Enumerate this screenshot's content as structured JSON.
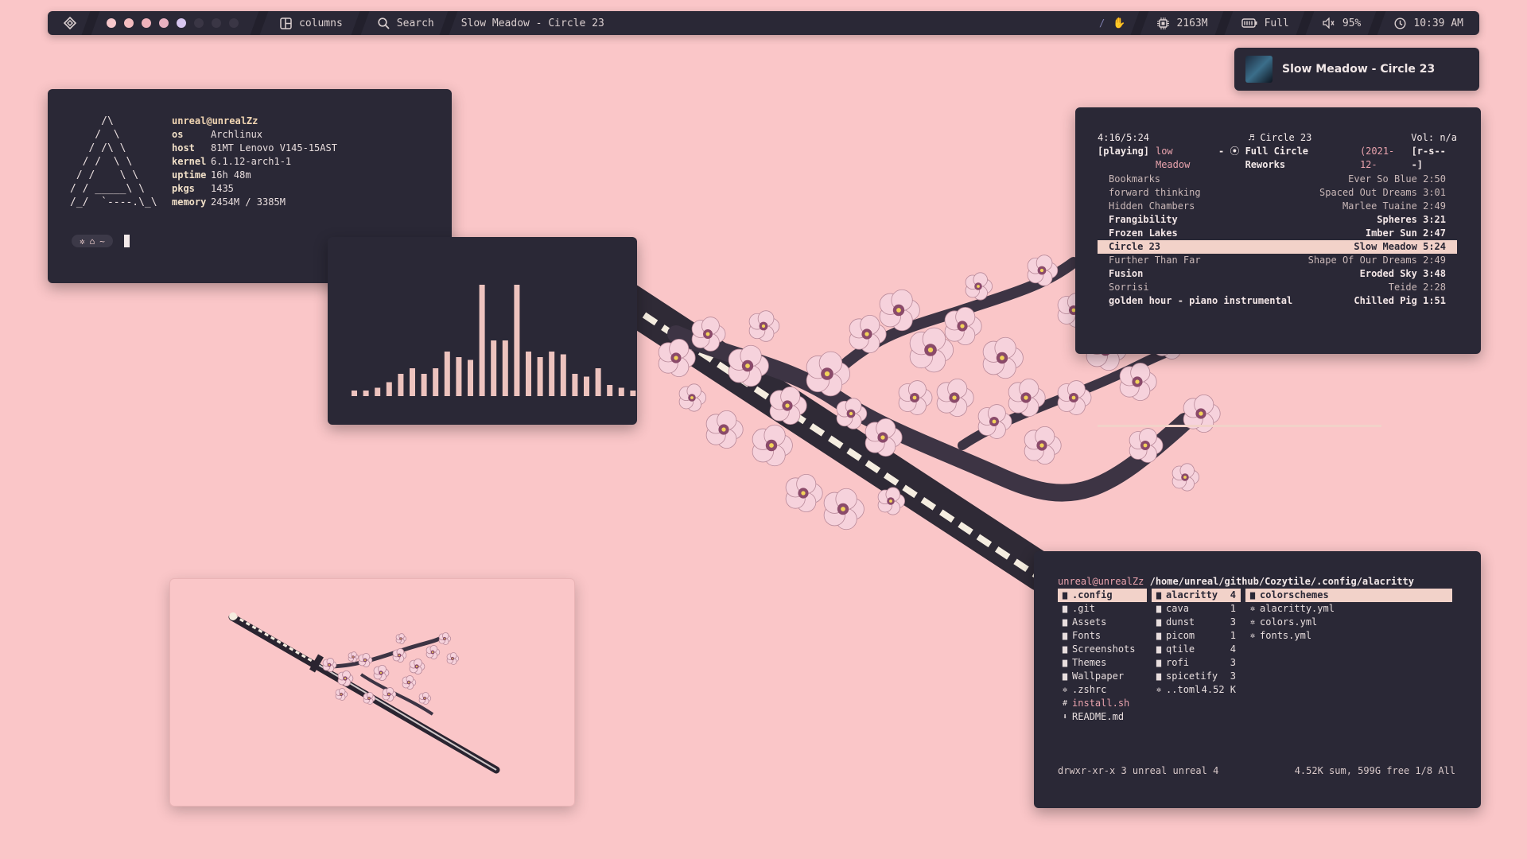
{
  "topbar": {
    "workspace_dots": [
      "#f7c7cb",
      "#f4bcc0",
      "#f0b2bb",
      "#e9b1c1",
      "#d8c6f0",
      "#3a3645",
      "#3a3645",
      "#3a3645"
    ],
    "layout_label": "columns",
    "search_label": "Search",
    "window_title": "Slow Meadow - Circle 23",
    "memory": "2163M",
    "battery": "Full",
    "volume": "95%",
    "clock": "10:39 AM"
  },
  "notification": {
    "text": "Slow Meadow - Circle 23"
  },
  "fetch": {
    "ascii": "     /\\\n    /  \\\n   / /\\ \\\n  / /  \\ \\\n / /    \\ \\\n/ / _____\\ \\\n/_/  `----.\\_\\",
    "user": "unreal@unrealZz",
    "rows": [
      {
        "key": "os",
        "value": "Archlinux"
      },
      {
        "key": "host",
        "value": "81MT Lenovo V145-15AST"
      },
      {
        "key": "kernel",
        "value": "6.1.12-arch1-1"
      },
      {
        "key": "uptime",
        "value": "16h 48m"
      },
      {
        "key": "pkgs",
        "value": "1435"
      },
      {
        "key": "memory",
        "value": "2454M / 3385M"
      }
    ],
    "prompt_path": "~"
  },
  "cava": {
    "levels": [
      2,
      2,
      3,
      5,
      8,
      10,
      8,
      10,
      16,
      14,
      13,
      40,
      20,
      20,
      40,
      16,
      14,
      16,
      15,
      8,
      7,
      10,
      4,
      3,
      2,
      2
    ]
  },
  "mpd": {
    "time": "4:16/5:24",
    "song": "Circle 23",
    "volume": "Vol: n/a",
    "status": "[playing]",
    "artist": "low Meadow",
    "album": "Full Circle Reworks",
    "date": "(2021-12-",
    "flags": "[r-s---]",
    "progress": 0.79,
    "tracks": [
      {
        "title": "Bookmarks",
        "right": "Ever So Blue 2:50",
        "style": "normal"
      },
      {
        "title": "forward thinking",
        "right": "Spaced Out Dreams 3:01",
        "style": "normal"
      },
      {
        "title": "Hidden Chambers",
        "right": "Marlee Tuaine 2:49",
        "style": "normal"
      },
      {
        "title": "Frangibility",
        "right": "Spheres 3:21",
        "style": "bold"
      },
      {
        "title": "Frozen Lakes",
        "right": "Imber Sun 2:47",
        "style": "bold"
      },
      {
        "title": "Circle 23",
        "right": "Slow Meadow 5:24",
        "style": "selected"
      },
      {
        "title": "Further Than Far",
        "right": "Shape Of Our Dreams 2:49",
        "style": "normal"
      },
      {
        "title": "Fusion",
        "right": "Eroded Sky 3:48",
        "style": "bold"
      },
      {
        "title": "Sorrisi",
        "right": "Teide 2:28",
        "style": "normal"
      },
      {
        "title": "golden hour - piano instrumental",
        "right": "Chilled Pig 1:51",
        "style": "bold"
      }
    ]
  },
  "ranger": {
    "user": "unreal@unrealZz",
    "path": "/home/unreal/github/Cozytile/.config/alacritty",
    "col1": [
      {
        "icon": "folder",
        "name": ".config",
        "sel": true
      },
      {
        "icon": "folder",
        "name": ".git"
      },
      {
        "icon": "folder",
        "name": "Assets"
      },
      {
        "icon": "folder",
        "name": "Fonts"
      },
      {
        "icon": "folder",
        "name": "Screenshots"
      },
      {
        "icon": "folder",
        "name": "Themes"
      },
      {
        "icon": "folder",
        "name": "Wallpaper"
      },
      {
        "icon": "gear",
        "name": ".zshrc"
      },
      {
        "icon": "hash",
        "name": "install.sh"
      },
      {
        "icon": "down",
        "name": "README.md"
      }
    ],
    "col2": [
      {
        "icon": "folder",
        "name": "alacritty",
        "count": "4",
        "sel": true
      },
      {
        "icon": "folder",
        "name": "cava",
        "count": "1"
      },
      {
        "icon": "folder",
        "name": "dunst",
        "count": "3"
      },
      {
        "icon": "folder",
        "name": "picom",
        "count": "1"
      },
      {
        "icon": "folder",
        "name": "qtile",
        "count": "4"
      },
      {
        "icon": "folder",
        "name": "rofi",
        "count": "3"
      },
      {
        "icon": "folder",
        "name": "spicetify",
        "count": "3"
      },
      {
        "icon": "gear",
        "name": "..toml",
        "count": "4.52 K"
      }
    ],
    "col3": [
      {
        "icon": "folder",
        "name": "colorschemes",
        "sel": true
      },
      {
        "icon": "gear",
        "name": "alacritty.yml"
      },
      {
        "icon": "gear",
        "name": "colors.yml"
      },
      {
        "icon": "gear",
        "name": "fonts.yml"
      }
    ],
    "status_left": "drwxr-xr-x 3 unreal unreal 4",
    "status_right": "4.52K sum, 599G free  1/8  All"
  }
}
